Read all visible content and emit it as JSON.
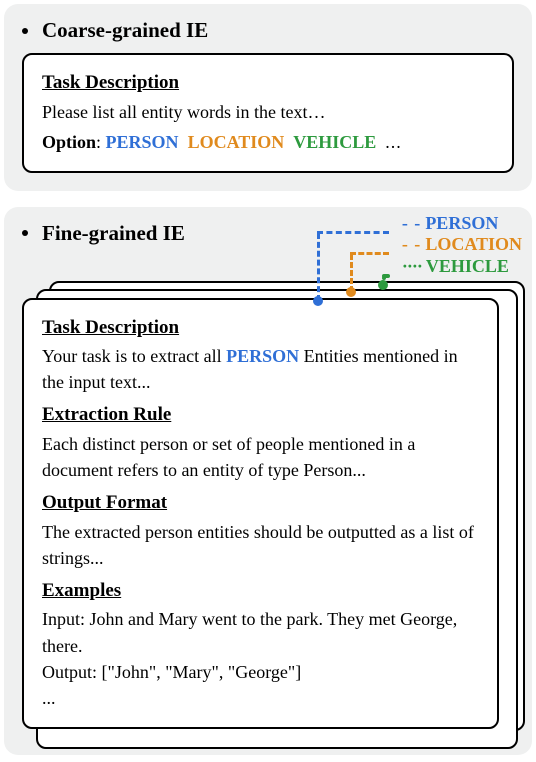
{
  "coarse": {
    "title": "Coarse-grained IE",
    "card": {
      "task_head": "Task Description",
      "task_text": "Please list all entity words in the text…",
      "option_label": "Option",
      "colon": ": ",
      "opts": {
        "person": "PERSON",
        "location": "LOCATION",
        "vehicle": "VEHICLE",
        "more": "..."
      }
    }
  },
  "fine": {
    "title": "Fine-grained IE",
    "labels": {
      "person": "PERSON",
      "location": "LOCATION",
      "vehicle": "VEHICLE"
    },
    "card": {
      "task_head": "Task Description",
      "task_pre": "Your task is to extract all ",
      "task_entity": "PERSON",
      "task_post": " Entities mentioned in the input text...",
      "rule_head": "Extraction Rule",
      "rule_text": "Each distinct person or set of people mentioned in a document refers to an entity of type Person...",
      "fmt_head": "Output Format",
      "fmt_text": "The extracted person entities should be outputted as a list of strings...",
      "ex_head": "Examples",
      "ex_input": "Input: John and Mary went to the park. They met George, there.",
      "ex_output": "Output: [\"John\", \"Mary\", \"George\"]",
      "more": "..."
    }
  }
}
